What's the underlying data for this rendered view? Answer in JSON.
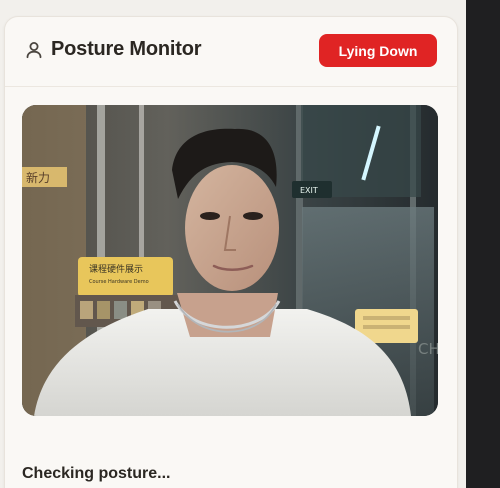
{
  "app": {
    "title": "Posture Monitor",
    "status_badge": "Lying Down",
    "status_message": "Checking posture..."
  },
  "camera_signage": {
    "left_sign_fragment": "新力",
    "center_banner_title": "课程硬件展示",
    "center_banner_subtitle": "Course Hardware Demo",
    "exit_sign": "EXIT",
    "door_text_fragment": "CHA"
  },
  "colors": {
    "badge_background": "#e02424",
    "card_background": "#faf8f5",
    "page_background": "#f2f0ec"
  },
  "icons": {
    "title_icon": "user-icon"
  }
}
